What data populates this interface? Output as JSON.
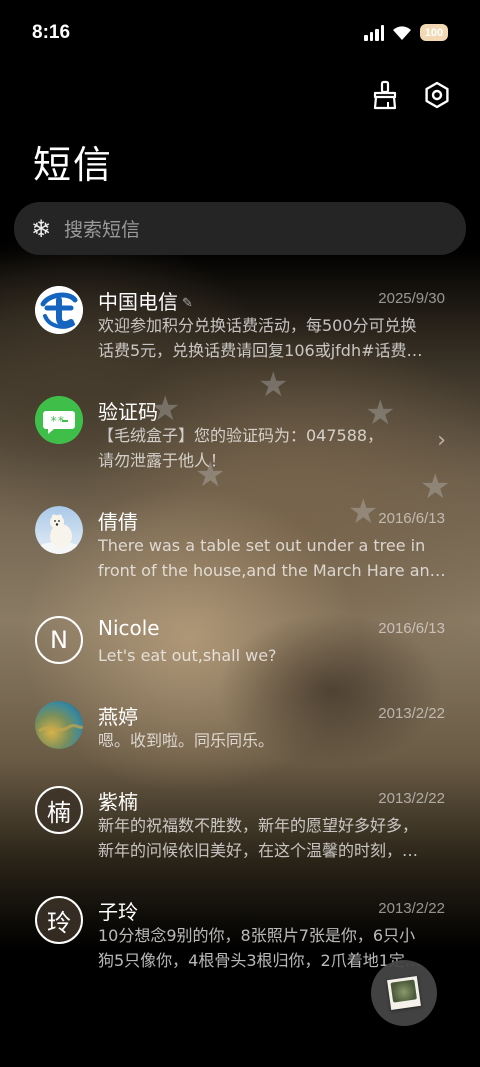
{
  "status": {
    "time": "8:16",
    "battery": "100"
  },
  "header": {
    "title": "短信",
    "clean_icon": "broom-icon",
    "settings_icon": "settings-icon"
  },
  "search": {
    "placeholder": "搜索短信",
    "icon": "snowflake-icon"
  },
  "conversations": [
    {
      "name": "中国电信",
      "date": "2025/9/30",
      "line1": "欢迎参加积分兑换话费活动，每500分可兑换",
      "line2": "话费5元，兑换话费请回复106或jfdh#话费…"
    },
    {
      "name": "验证码",
      "date": "",
      "line1": "【毛绒盒子】您的验证码为：047588，",
      "line2": "请勿泄露于他人！",
      "bubble_text": "**"
    },
    {
      "name": "倩倩",
      "date": "2016/6/13",
      "line1": "There was a table set out under a tree in",
      "line2": "front of the house,and the March Hare an…"
    },
    {
      "name": "Nicole",
      "date": "2016/6/13",
      "line1": "Let's eat out,shall we?",
      "line2": "",
      "avatar_letter": "N"
    },
    {
      "name": "燕婷",
      "date": "2013/2/22",
      "line1": "嗯。收到啦。同乐同乐。",
      "line2": ""
    },
    {
      "name": "紫楠",
      "date": "2013/2/22",
      "line1": "新年的祝福数不胜数，新年的愿望好多好多，",
      "line2": "新年的问候依旧美好，在这个温馨的时刻，…",
      "avatar_letter": "楠"
    },
    {
      "name": "子玲",
      "date": "2013/2/22",
      "line1": "10分想念9别的你，8张照片7张是你，6只小",
      "line2": "狗5只像你，4根骨头3根归你，2爪着地1定…",
      "avatar_letter": "玲"
    }
  ],
  "colors": {
    "telecom_blue": "#1565c0",
    "verify_green": "#3fbf4a"
  }
}
